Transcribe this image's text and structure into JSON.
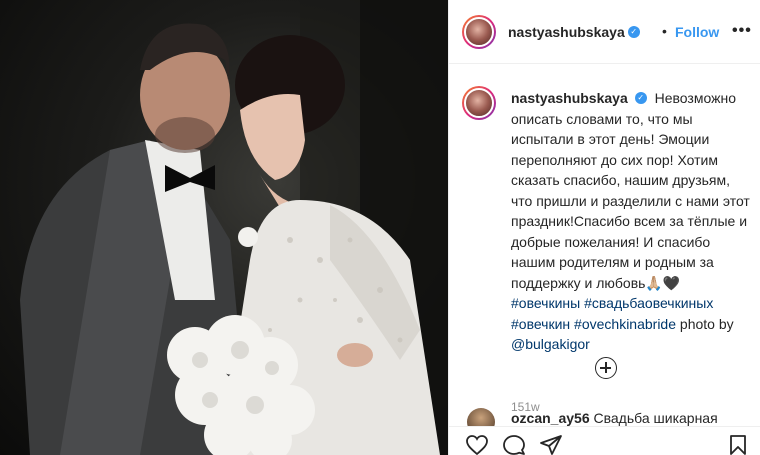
{
  "post": {
    "username": "nastyashubskaya",
    "follow_label": "Follow",
    "dot": "•",
    "more_label": "•••",
    "verified_mark": "✓"
  },
  "caption": {
    "username": "nastyashubskaya",
    "text": "Невозможно описать словами то, что мы испытали в этот день! Эмоции переполняют до сих пор! Хотим сказать спасибо, нашим друзьям, что пришли и разделили с нами этот праздник!Спасибо всем за тёплые и добрые пожелания! И спасибо нашим родителям и родным за поддержку и любовь🙏🏼🖤",
    "hashtags": [
      "#овечкины",
      "#свадьбаовечкиных",
      "#овечкин",
      "#ovechkinabride"
    ],
    "photo_by": "photo by",
    "mention": "@bulgakigor",
    "timestamp": "151w"
  },
  "comment": {
    "username": "ozcan_ay56",
    "text": "Свадьба шикарная"
  },
  "icons": {
    "like": "heart-icon",
    "comment": "comment-icon",
    "share": "share-icon",
    "save": "bookmark-icon",
    "load_more": "plus-circle-icon",
    "more": "more-options-icon",
    "verified": "verified-badge-icon"
  },
  "colors": {
    "link_blue": "#3897f0",
    "hashtag": "#00376b",
    "muted": "#8e8e8e",
    "text": "#262626"
  }
}
